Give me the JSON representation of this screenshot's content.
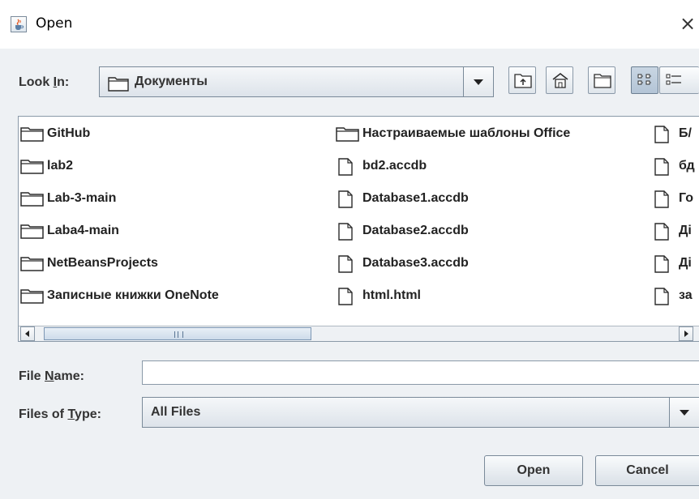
{
  "window": {
    "title": "Open",
    "close_glyph": "×",
    "app_icon": "java-cup-icon"
  },
  "look_in": {
    "label_pre": "Look ",
    "label_mnemonic": "I",
    "label_post": "n:",
    "value": "Документы",
    "value_icon": "folder-icon"
  },
  "toolbar": {
    "buttons": [
      {
        "name": "up-one-level",
        "icon": "folder-up-icon"
      },
      {
        "name": "home",
        "icon": "home-icon"
      },
      {
        "name": "create-new-folder",
        "icon": "new-folder-icon"
      },
      {
        "name": "list-view",
        "icon": "list-view-icon",
        "pressed": true
      },
      {
        "name": "details-view",
        "icon": "details-view-icon"
      }
    ]
  },
  "files": {
    "columns": [
      [
        {
          "name": "GitHub",
          "type": "folder"
        },
        {
          "name": "lab2",
          "type": "folder"
        },
        {
          "name": "Lab-3-main",
          "type": "folder"
        },
        {
          "name": "Laba4-main",
          "type": "folder"
        },
        {
          "name": "NetBeansProjects",
          "type": "folder"
        },
        {
          "name": "Записные книжки OneNote",
          "type": "folder"
        }
      ],
      [
        {
          "name": "Настраиваемые шаблоны Office",
          "type": "folder"
        },
        {
          "name": "bd2.accdb",
          "type": "file"
        },
        {
          "name": "Database1.accdb",
          "type": "file"
        },
        {
          "name": "Database2.accdb",
          "type": "file"
        },
        {
          "name": "Database3.accdb",
          "type": "file"
        },
        {
          "name": "html.html",
          "type": "file"
        }
      ],
      [
        {
          "name": "Б/",
          "type": "file"
        },
        {
          "name": "бд",
          "type": "file"
        },
        {
          "name": "Го",
          "type": "file"
        },
        {
          "name": "Ді",
          "type": "file"
        },
        {
          "name": "Ді",
          "type": "file"
        },
        {
          "name": "за",
          "type": "file"
        }
      ]
    ]
  },
  "file_name": {
    "label_pre": "File ",
    "label_mnemonic": "N",
    "label_post": "ame:",
    "value": ""
  },
  "files_of_type": {
    "label_pre": "Files of ",
    "label_mnemonic": "T",
    "label_post": "ype:",
    "value": "All Files"
  },
  "buttons": {
    "open": "Open",
    "cancel": "Cancel"
  },
  "colors": {
    "panel_bg": "#eef1f4",
    "border": "#8a99a8"
  }
}
